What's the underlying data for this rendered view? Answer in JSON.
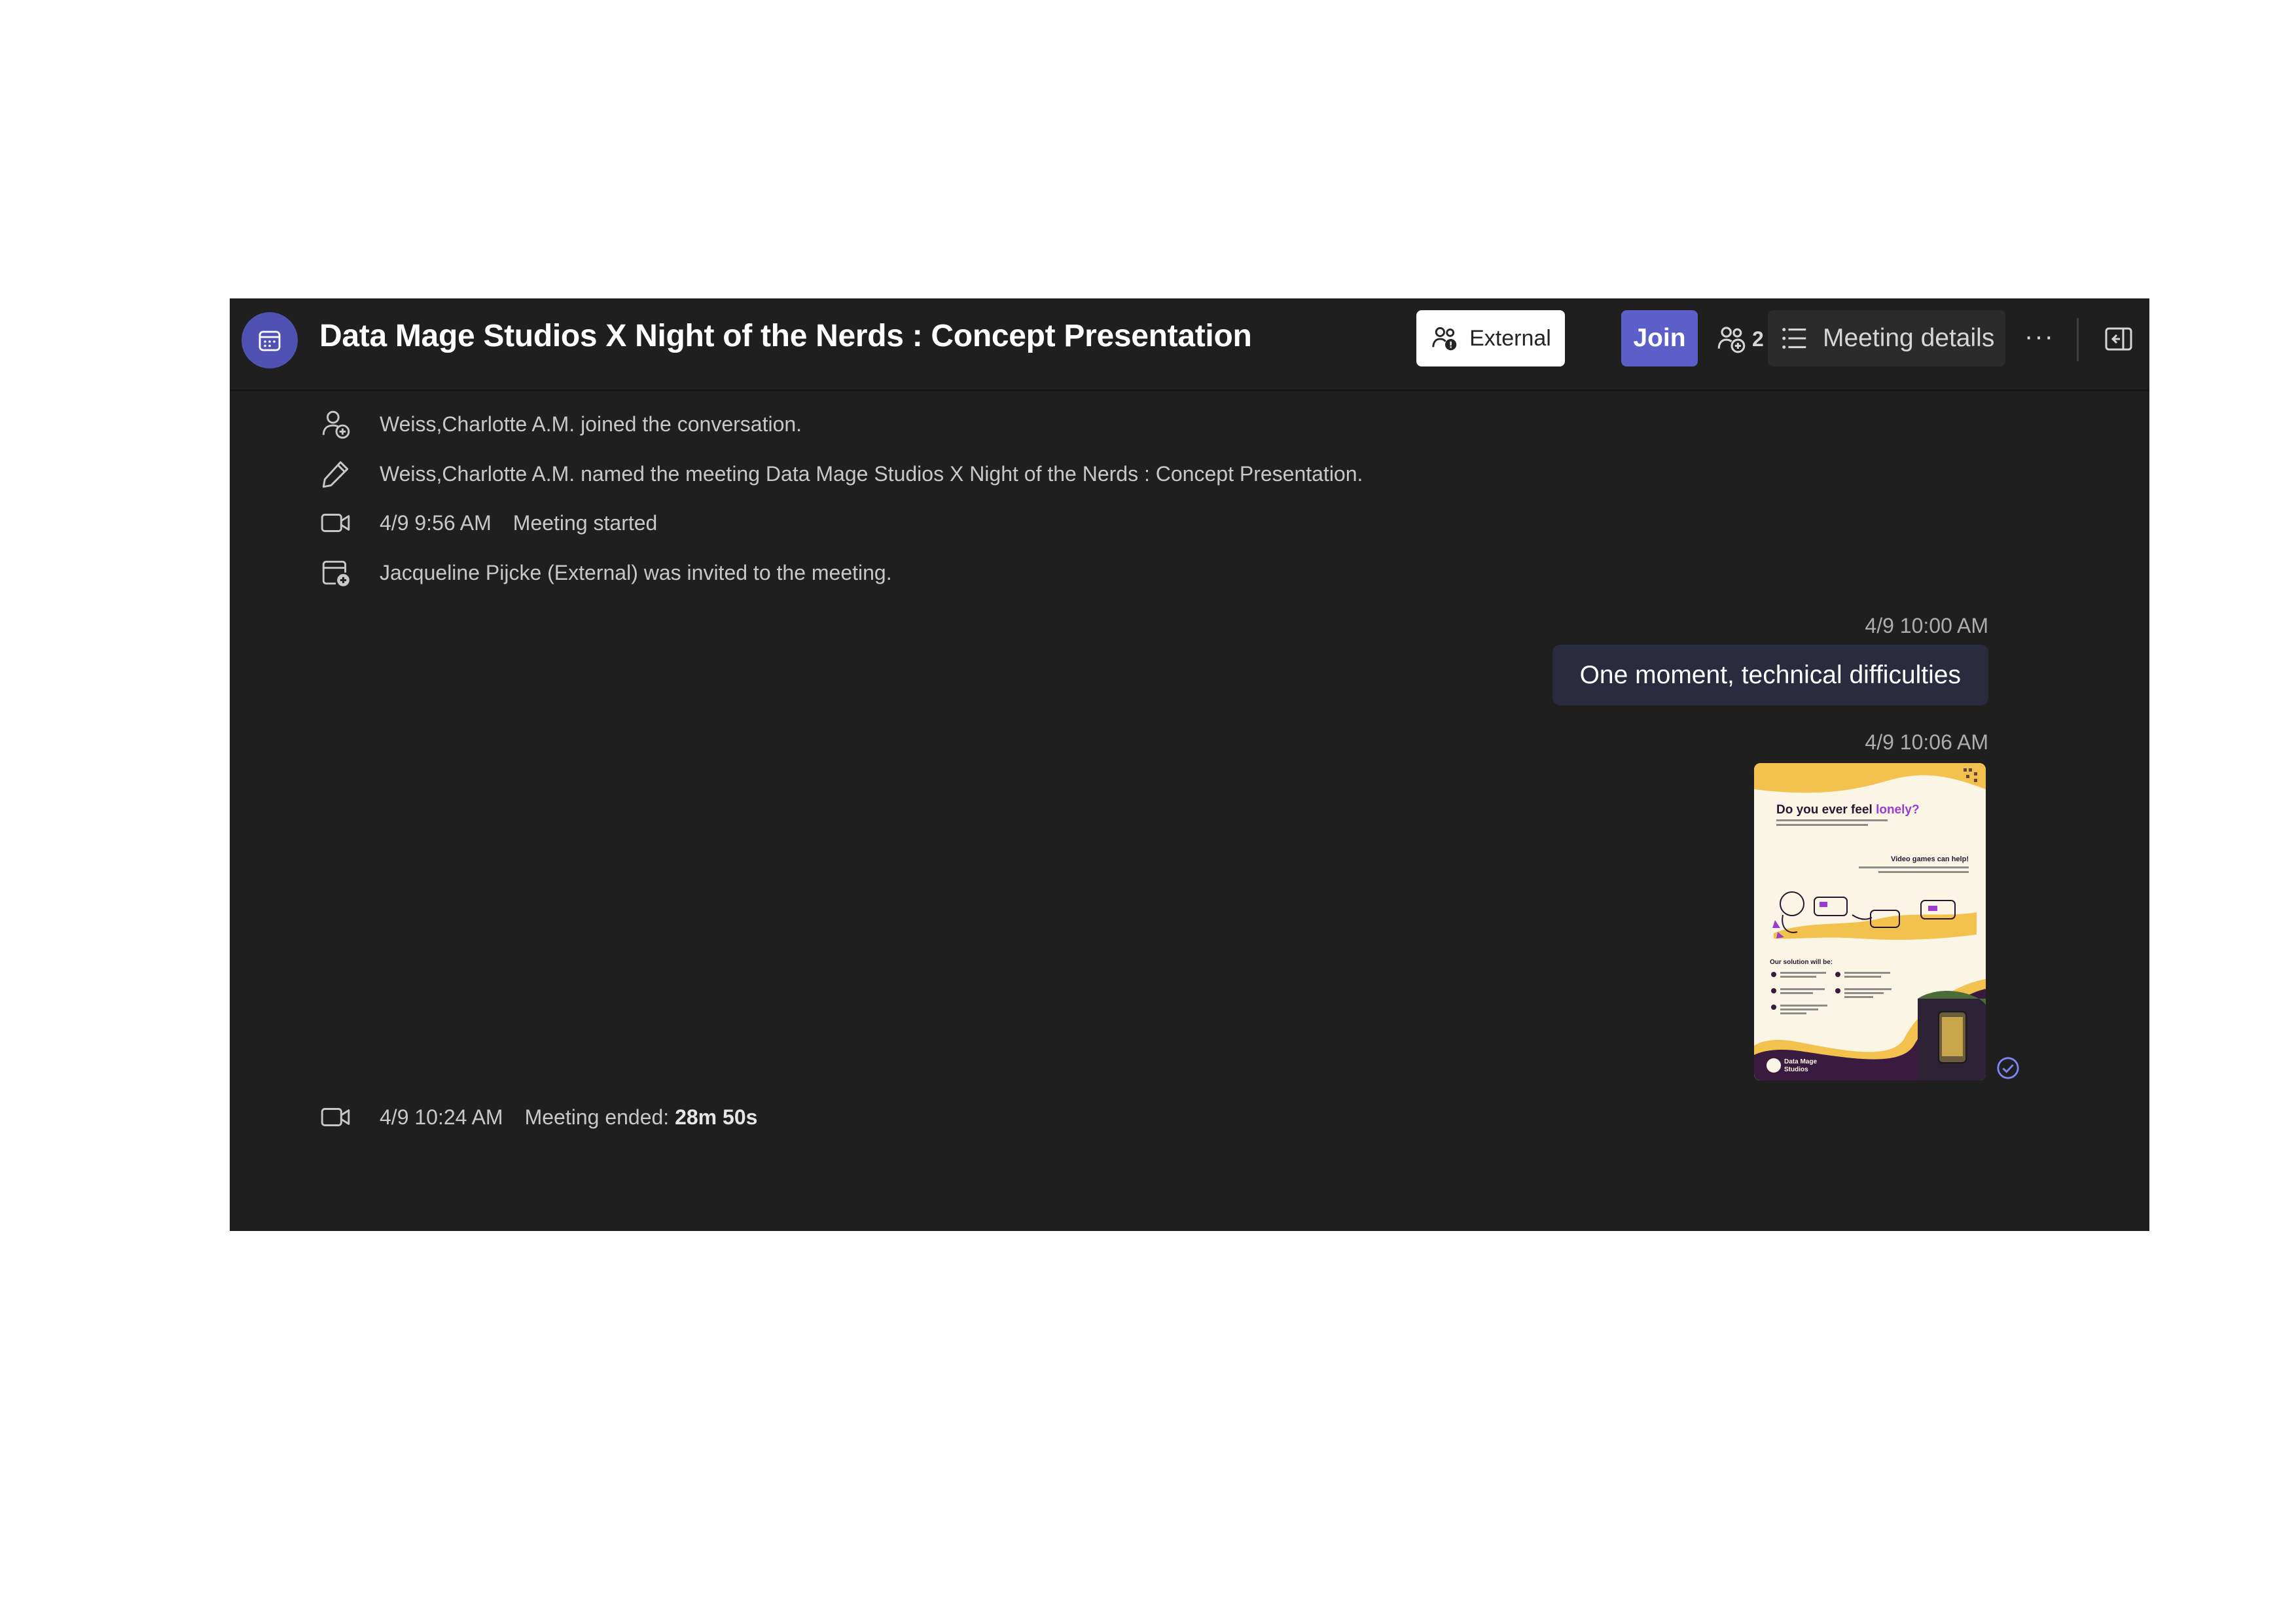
{
  "header": {
    "title": "Data Mage Studios X Night of the Nerds : Concept Presentation",
    "external_label": "External",
    "join_label": "Join",
    "participant_count": "2",
    "details_label": "Meeting details",
    "more_label": "···"
  },
  "events": [
    {
      "icon": "person-add-icon",
      "text": "Weiss,Charlotte A.M. joined the conversation."
    },
    {
      "icon": "pencil-icon",
      "text": "Weiss,Charlotte A.M. named the meeting Data Mage Studios X Night of the Nerds : Concept Presentation."
    },
    {
      "icon": "video-camera-icon",
      "time": "4/9 9:56 AM",
      "text": "Meeting started"
    },
    {
      "icon": "calendar-add-icon",
      "text": "Jacqueline Pijcke (External) was invited to the meeting."
    }
  ],
  "messages": [
    {
      "time": "4/9 10:00 AM",
      "text": "One moment, technical difficulties"
    },
    {
      "time": "4/9 10:06 AM",
      "attachment": "poster-image"
    }
  ],
  "poster": {
    "headline_a": "Do you ever feel ",
    "headline_b": "lonely?",
    "sub": "Video games can help!",
    "solution": "Our solution will be:",
    "brand_a": "Data Mage",
    "brand_b": "Studios"
  },
  "ended": {
    "time": "4/9 10:24 AM",
    "text": "Meeting ended: ",
    "duration": "28m 50s"
  },
  "colors": {
    "accent": "#5b5fc7",
    "background": "#1f1f1f",
    "bubble": "#2b2b40",
    "poster_purple": "#3a1a3e",
    "poster_yellow": "#f2c14e"
  }
}
